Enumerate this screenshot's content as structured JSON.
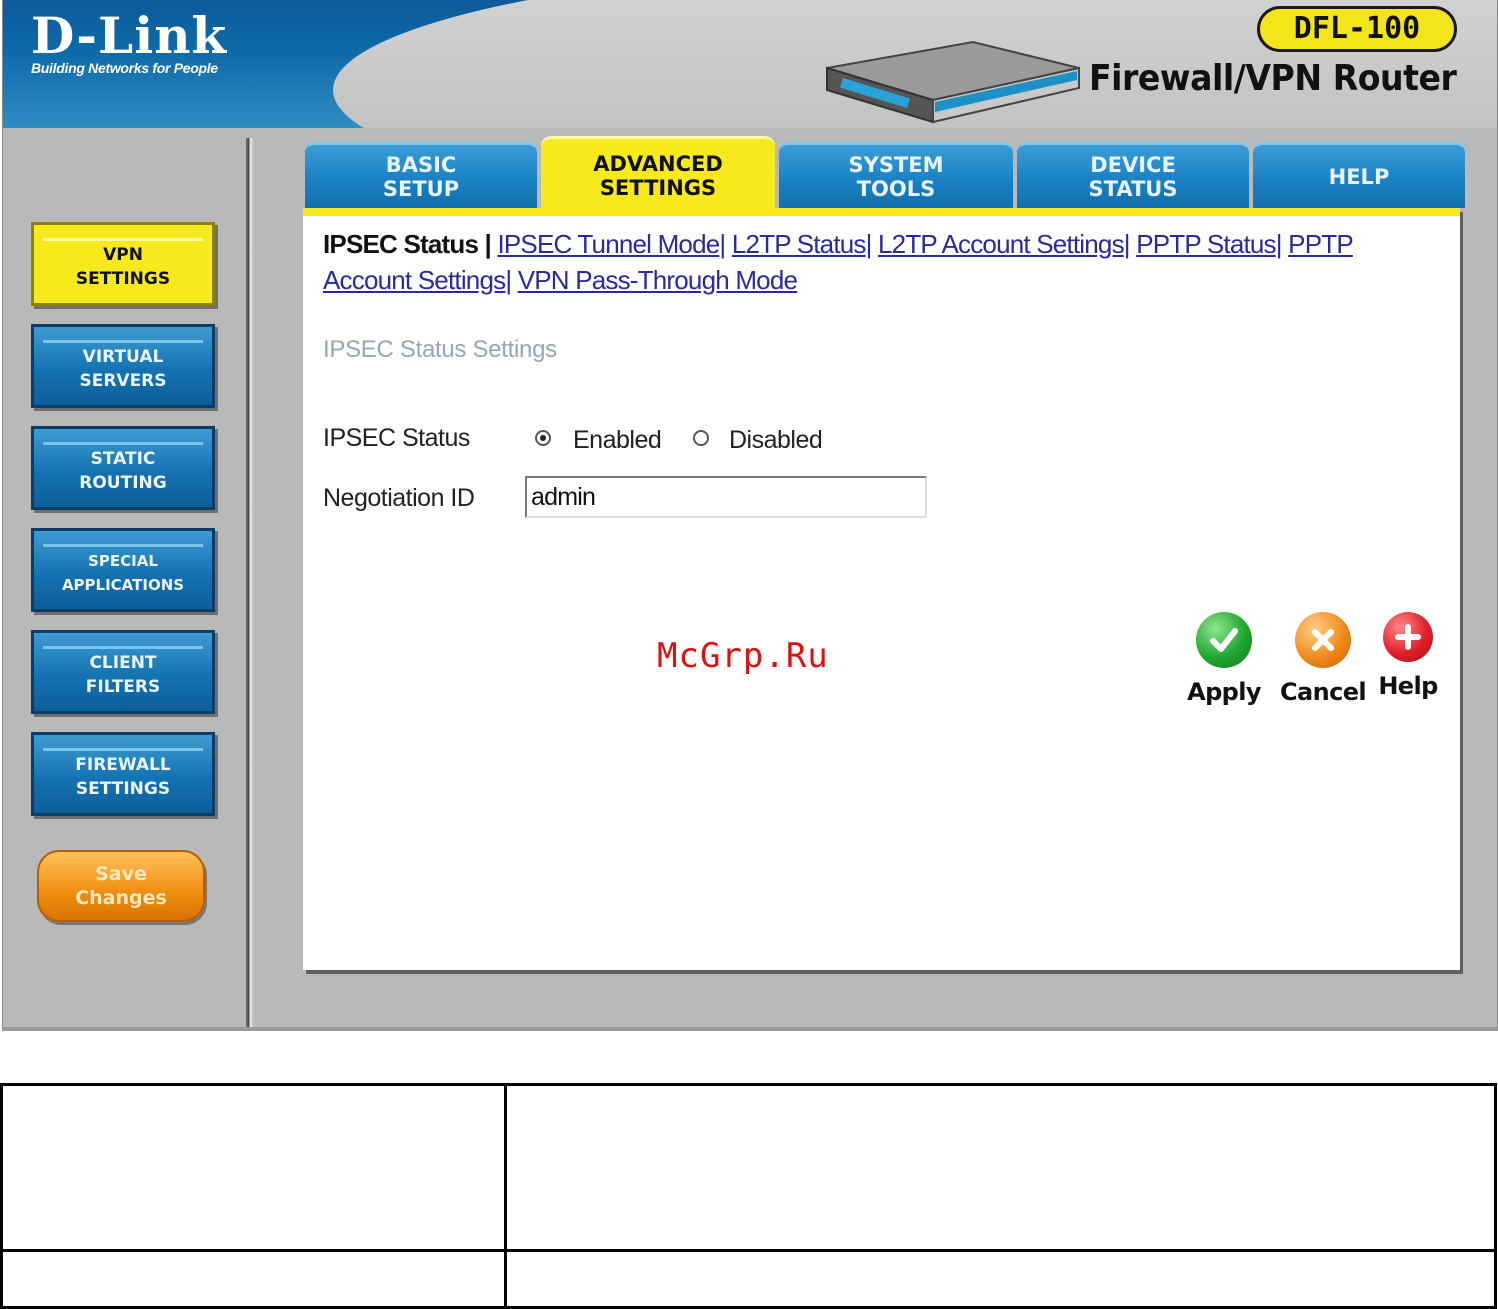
{
  "header": {
    "brand": "D-Link",
    "tagline": "Building Networks for People",
    "model": "DFL-100",
    "product": "Firewall/VPN Router"
  },
  "tabs": [
    {
      "line1": "BASIC",
      "line2": "SETUP",
      "active": false
    },
    {
      "line1": "ADVANCED",
      "line2": "SETTINGS",
      "active": true
    },
    {
      "line1": "SYSTEM",
      "line2": "TOOLS",
      "active": false
    },
    {
      "line1": "DEVICE",
      "line2": "STATUS",
      "active": false
    },
    {
      "line1": "HELP",
      "line2": "",
      "active": false
    }
  ],
  "sidebar": {
    "items": [
      {
        "line1": "VPN",
        "line2": "SETTINGS",
        "active": true
      },
      {
        "line1": "VIRTUAL",
        "line2": "SERVERS",
        "active": false
      },
      {
        "line1": "STATIC",
        "line2": "ROUTING",
        "active": false
      },
      {
        "line1": "SPECIAL",
        "line2": "APPLICATIONS",
        "active": false
      },
      {
        "line1": "CLIENT",
        "line2": "FILTERS",
        "active": false
      },
      {
        "line1": "FIREWALL",
        "line2": "SETTINGS",
        "active": false
      }
    ],
    "save": {
      "line1": "Save",
      "line2": "Changes"
    }
  },
  "subnav": {
    "current": "IPSEC Status",
    "links": [
      "IPSEC Tunnel Mode",
      "L2TP Status",
      "L2TP Account Settings",
      "PPTP Status",
      "PPTP Account Settings",
      "VPN Pass-Through Mode"
    ]
  },
  "main": {
    "section_title": "IPSEC Status Settings",
    "ipsec_status_label": "IPSEC Status",
    "enabled_label": "Enabled",
    "disabled_label": "Disabled",
    "ipsec_status_value": "Enabled",
    "negotiation_label": "Negotiation ID",
    "negotiation_value": "admin"
  },
  "actions": {
    "apply": "Apply",
    "cancel": "Cancel",
    "help": "Help"
  },
  "watermark": "McGrp.Ru",
  "colors": {
    "accent_yellow": "#f6ea1e",
    "tab_blue": "#1780c2",
    "apply_green": "#1fa531",
    "cancel_orange": "#f08a1c",
    "help_red": "#e0202a"
  }
}
